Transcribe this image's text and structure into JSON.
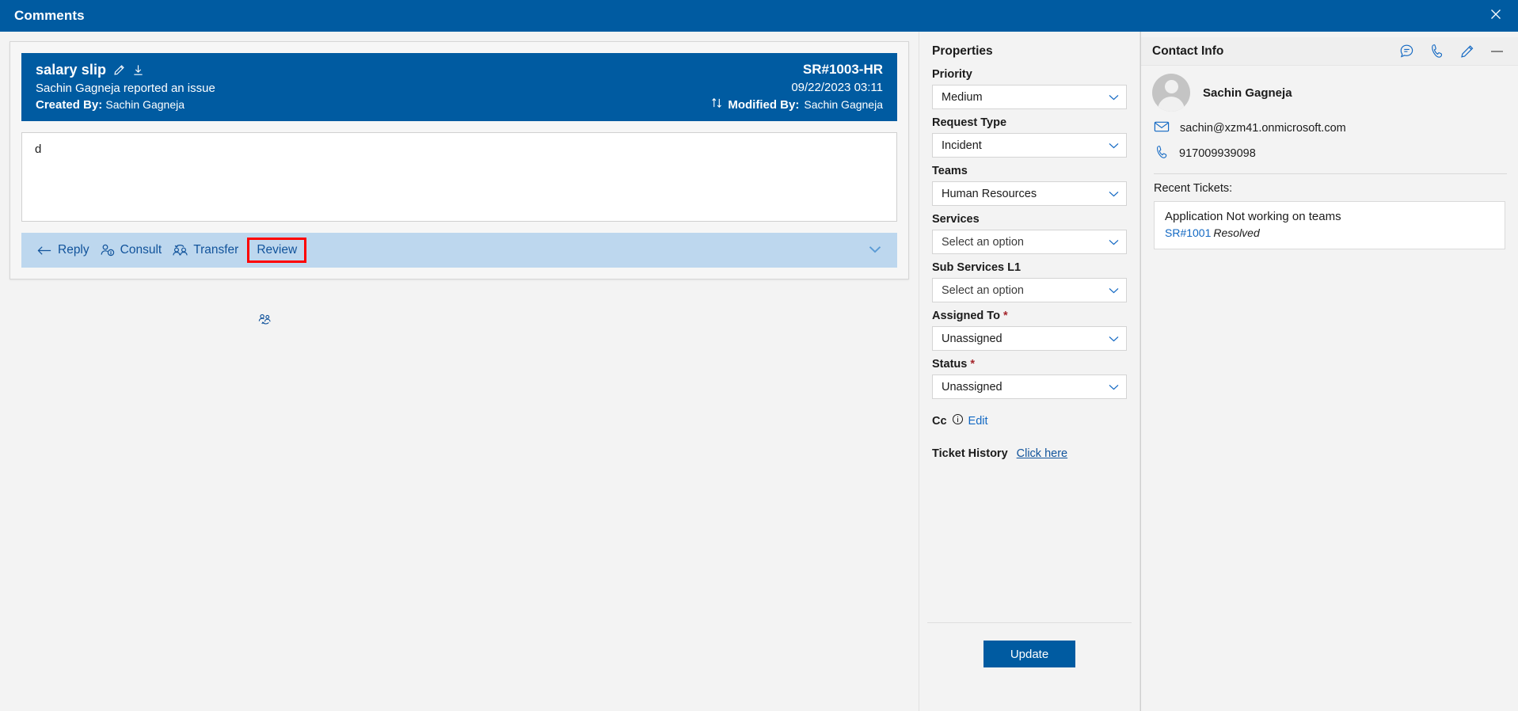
{
  "window": {
    "title": "Comments",
    "close_icon": "close-icon"
  },
  "ticket": {
    "subject": "salary slip",
    "edit_icon": "pencil-icon",
    "download_icon": "download-icon",
    "reported_line": "Sachin Gagneja reported an issue",
    "created_by_label": "Created By:",
    "created_by_value": "Sachin Gagneja",
    "id": "SR#1003-HR",
    "datetime": "09/22/2023 03:11",
    "sort_icon": "sort-updown-icon",
    "modified_by_label": "Modified By:",
    "modified_by_value": "Sachin Gagneja",
    "body_text": "d"
  },
  "action_bar": {
    "items": [
      {
        "label": "Reply",
        "icon": "reply-arrow-icon",
        "highlighted": false
      },
      {
        "label": "Consult",
        "icon": "person-info-icon",
        "highlighted": false
      },
      {
        "label": "Transfer",
        "icon": "people-transfer-icon",
        "highlighted": false
      },
      {
        "label": "Review",
        "icon": "people-sync-icon",
        "highlighted": true
      }
    ],
    "expand_icon": "chevron-down-icon"
  },
  "properties": {
    "title": "Properties",
    "fields": [
      {
        "label": "Priority",
        "value": "Medium",
        "required": false,
        "placeholder": false
      },
      {
        "label": "Request Type",
        "value": "Incident",
        "required": false,
        "placeholder": false
      },
      {
        "label": "Teams",
        "value": "Human Resources",
        "required": false,
        "placeholder": false
      },
      {
        "label": "Services",
        "value": "Select an option",
        "required": false,
        "placeholder": true
      },
      {
        "label": "Sub Services L1",
        "value": "Select an option",
        "required": false,
        "placeholder": true
      },
      {
        "label": "Assigned To",
        "value": "Unassigned",
        "required": true,
        "placeholder": false
      },
      {
        "label": "Status",
        "value": "Unassigned",
        "required": true,
        "placeholder": false
      }
    ],
    "cc_label": "Cc",
    "cc_info_icon": "info-circle-icon",
    "cc_edit_label": "Edit",
    "history_label": "Ticket History",
    "history_link": "Click here",
    "update_label": "Update"
  },
  "contact": {
    "title": "Contact Info",
    "header_icons": [
      {
        "name": "chat-icon"
      },
      {
        "name": "phone-icon"
      },
      {
        "name": "pencil-icon"
      },
      {
        "name": "minimize-icon"
      }
    ],
    "avatar_name": "avatar",
    "name": "Sachin Gagneja",
    "email": "sachin@xzm41.onmicrosoft.com",
    "email_icon": "envelope-icon",
    "phone": "917009939098",
    "phone_icon": "phone-icon",
    "recent_label": "Recent Tickets:",
    "recent_tickets": [
      {
        "title": "Application Not working on teams",
        "id": "SR#1001",
        "status": "Resolved"
      }
    ]
  },
  "colors": {
    "brand_blue": "#005ba1",
    "action_bar_blue": "#bdd7ee",
    "link_blue": "#1268c3",
    "highlight_red": "#ff0000",
    "required_red": "#a4262c"
  }
}
